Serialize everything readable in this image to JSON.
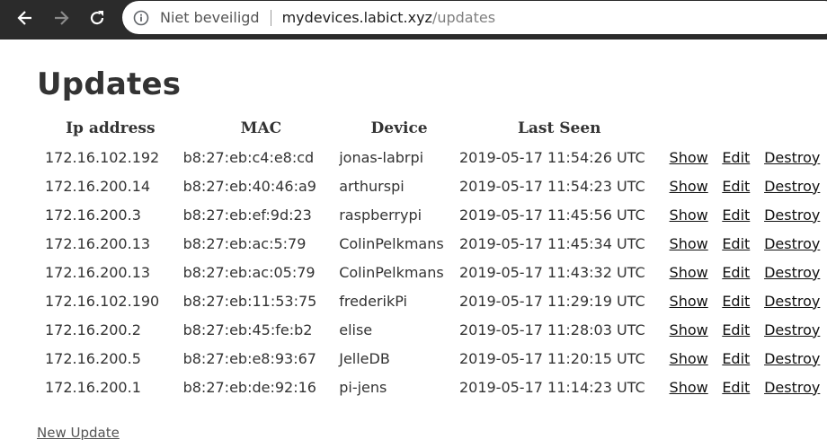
{
  "browser": {
    "security_label": "Niet beveiligd",
    "host": "mydevices.labict.xyz",
    "path": "/updates"
  },
  "page": {
    "title": "Updates",
    "new_link": "New Update"
  },
  "table": {
    "headers": [
      "Ip address",
      "MAC",
      "Device",
      "Last Seen"
    ],
    "action_labels": {
      "show": "Show",
      "edit": "Edit",
      "destroy": "Destroy"
    },
    "rows": [
      {
        "ip": "172.16.102.192",
        "mac": "b8:27:eb:c4:e8:cd",
        "device": "jonas-labrpi",
        "last_seen": "2019-05-17 11:54:26 UTC"
      },
      {
        "ip": "172.16.200.14",
        "mac": "b8:27:eb:40:46:a9",
        "device": "arthurspi",
        "last_seen": "2019-05-17 11:54:23 UTC"
      },
      {
        "ip": "172.16.200.3",
        "mac": "b8:27:eb:ef:9d:23",
        "device": "raspberrypi",
        "last_seen": "2019-05-17 11:45:56 UTC"
      },
      {
        "ip": "172.16.200.13",
        "mac": "b8:27:eb:ac:5:79",
        "device": "ColinPelkmans",
        "last_seen": "2019-05-17 11:45:34 UTC"
      },
      {
        "ip": "172.16.200.13",
        "mac": "b8:27:eb:ac:05:79",
        "device": "ColinPelkmans",
        "last_seen": "2019-05-17 11:43:32 UTC"
      },
      {
        "ip": "172.16.102.190",
        "mac": "b8:27:eb:11:53:75",
        "device": "frederikPi",
        "last_seen": "2019-05-17 11:29:19 UTC"
      },
      {
        "ip": "172.16.200.2",
        "mac": "b8:27:eb:45:fe:b2",
        "device": "elise",
        "last_seen": "2019-05-17 11:28:03 UTC"
      },
      {
        "ip": "172.16.200.5",
        "mac": "b8:27:eb:e8:93:67",
        "device": "JelleDB",
        "last_seen": "2019-05-17 11:20:15 UTC"
      },
      {
        "ip": "172.16.200.1",
        "mac": "b8:27:eb:de:92:16",
        "device": "pi-jens",
        "last_seen": "2019-05-17 11:14:23 UTC"
      }
    ]
  },
  "colors": {
    "chrome_bg": "#2b2b2b",
    "text": "#333333",
    "link": "#111111"
  },
  "icons": [
    "back-arrow-icon",
    "forward-arrow-icon",
    "reload-icon",
    "info-icon"
  ]
}
